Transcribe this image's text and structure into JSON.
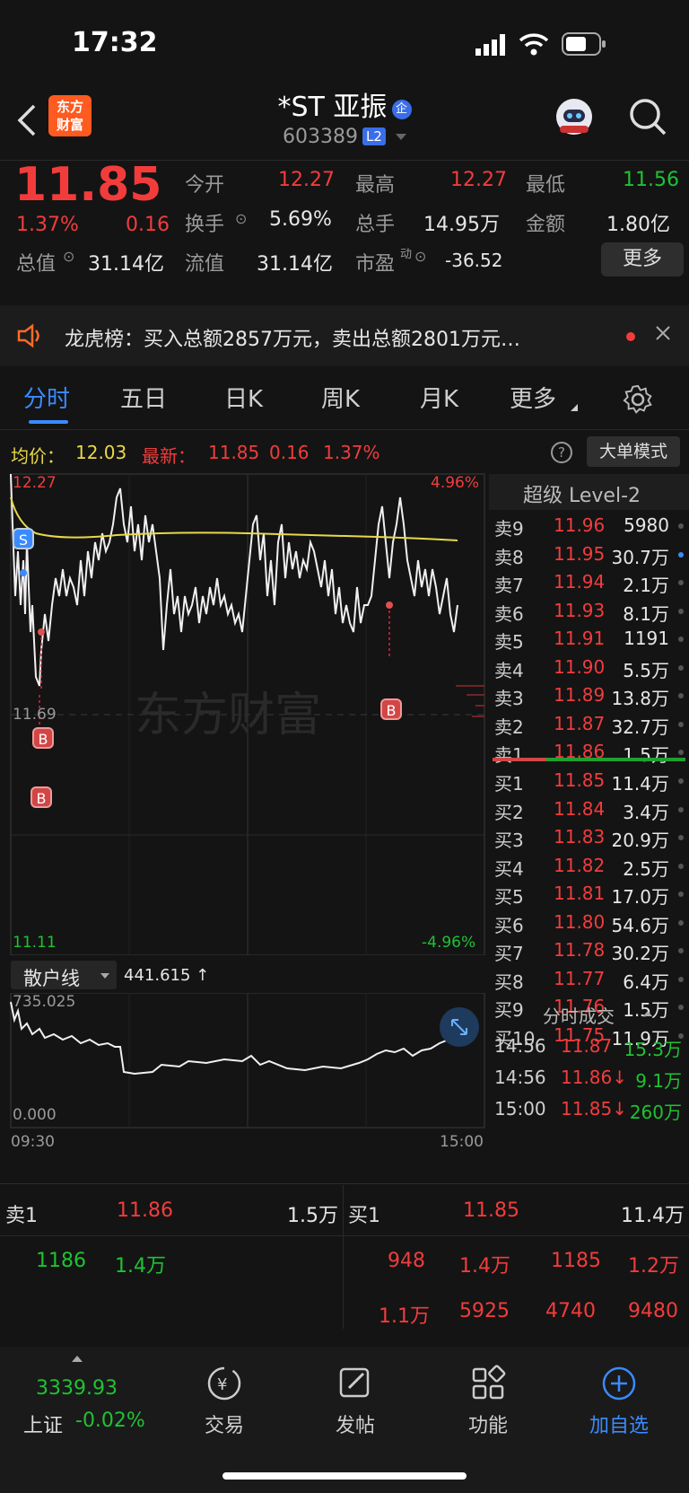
{
  "status": {
    "time": "17:32"
  },
  "header": {
    "title": "*ST 亚振",
    "badge": "企",
    "code": "603389",
    "level": "L2",
    "logo": "东方\n财富"
  },
  "quote": {
    "price": "11.85",
    "pct": "1.37%",
    "change": "0.16",
    "rows": [
      [
        {
          "label": "今开",
          "value": "12.27",
          "cls": "red"
        },
        {
          "label": "最高",
          "value": "12.27",
          "cls": "red"
        },
        {
          "label": "最低",
          "value": "11.56",
          "cls": "green"
        }
      ],
      [
        {
          "label": "换手",
          "value": "5.69%",
          "cls": "white"
        },
        {
          "label": "总手",
          "value": "14.95万",
          "cls": "white"
        },
        {
          "label": "金额",
          "value": "1.80亿",
          "cls": "white"
        }
      ],
      [
        {
          "label": "总值",
          "value": "31.14亿",
          "cls": "white"
        },
        {
          "label": "流值",
          "value": "31.14亿",
          "cls": "white"
        },
        {
          "label": "市盈",
          "value": "-36.52",
          "cls": "white"
        }
      ]
    ],
    "more": "更多",
    "dong": "动"
  },
  "banner": {
    "text": "龙虎榜：买入总额2857万元，卖出总额2801万元…"
  },
  "tabs": [
    "分时",
    "五日",
    "日K",
    "周K",
    "月K",
    "更多"
  ],
  "info": {
    "avg_label": "均价：",
    "avg": "12.03",
    "latest_label": "最新：",
    "latest": "11.85",
    "chg": "0.16",
    "pct": "1.37%",
    "mode": "大单模式"
  },
  "chart": {
    "top": "12.27",
    "top_pct": "4.96%",
    "bottom": "11.11",
    "bottom_pct": "-4.96%",
    "ref": "11.69",
    "watermark": "东方财富",
    "marker_b": "B",
    "marker_s": "S"
  },
  "indicator": {
    "name": "散户线",
    "value": "441.615 ↑",
    "max": "735.025",
    "min": "0.000",
    "t_start": "09:30",
    "t_end": "15:00"
  },
  "book": {
    "title": "超级 Level-2",
    "asks": [
      {
        "label": "卖9",
        "price": "11.96",
        "vol": "5980",
        "cls": "red"
      },
      {
        "label": "卖8",
        "price": "11.95",
        "vol": "30.7万",
        "cls": "red"
      },
      {
        "label": "卖7",
        "price": "11.94",
        "vol": "2.1万",
        "cls": "red"
      },
      {
        "label": "卖6",
        "price": "11.93",
        "vol": "8.1万",
        "cls": "red"
      },
      {
        "label": "卖5",
        "price": "11.91",
        "vol": "1191",
        "cls": "red"
      },
      {
        "label": "卖4",
        "price": "11.90",
        "vol": "5.5万",
        "cls": "red"
      },
      {
        "label": "卖3",
        "price": "11.89",
        "vol": "13.8万",
        "cls": "red"
      },
      {
        "label": "卖2",
        "price": "11.87",
        "vol": "32.7万",
        "cls": "red"
      },
      {
        "label": "卖1",
        "price": "11.86",
        "vol": "1.5万",
        "cls": "red"
      }
    ],
    "bids": [
      {
        "label": "买1",
        "price": "11.85",
        "vol": "11.4万",
        "cls": "red"
      },
      {
        "label": "买2",
        "price": "11.84",
        "vol": "3.4万",
        "cls": "red"
      },
      {
        "label": "买3",
        "price": "11.83",
        "vol": "20.9万",
        "cls": "red"
      },
      {
        "label": "买4",
        "price": "11.82",
        "vol": "2.5万",
        "cls": "red"
      },
      {
        "label": "买5",
        "price": "11.81",
        "vol": "17.0万",
        "cls": "red"
      },
      {
        "label": "买6",
        "price": "11.80",
        "vol": "54.6万",
        "cls": "red"
      },
      {
        "label": "买7",
        "price": "11.78",
        "vol": "30.2万",
        "cls": "red"
      },
      {
        "label": "买8",
        "price": "11.77",
        "vol": "6.4万",
        "cls": "red"
      },
      {
        "label": "买9",
        "price": "11.76",
        "vol": "1.5万",
        "cls": "red"
      },
      {
        "label": "买10",
        "price": "11.75",
        "vol": "11.9万",
        "cls": "red"
      }
    ],
    "trades_title": "分时成交",
    "trades": [
      {
        "time": "14:56",
        "price": "11.87",
        "vol": "15.3万",
        "cls": "green"
      },
      {
        "time": "14:56",
        "price": "11.86↓",
        "vol": "9.1万",
        "cls": "green"
      },
      {
        "time": "15:00",
        "price": "11.85↓",
        "vol": "260万",
        "cls": "green"
      }
    ]
  },
  "bottom": {
    "sell_label": "卖1",
    "sell_price": "11.86",
    "sell_vol": "1.5万",
    "buy_label": "买1",
    "buy_price": "11.85",
    "buy_vol": "11.4万",
    "sell_q": [
      "1186",
      "1.4万"
    ],
    "buy_q1": [
      "948",
      "1.4万",
      "1185",
      "1.2万"
    ],
    "buy_q2": [
      "1.1万",
      "5925",
      "4740",
      "9480"
    ]
  },
  "nav": {
    "index_value": "3339.93",
    "index_name": "上证",
    "index_pct": "-0.02%",
    "items": [
      "交易",
      "发帖",
      "功能",
      "加自选"
    ]
  }
}
